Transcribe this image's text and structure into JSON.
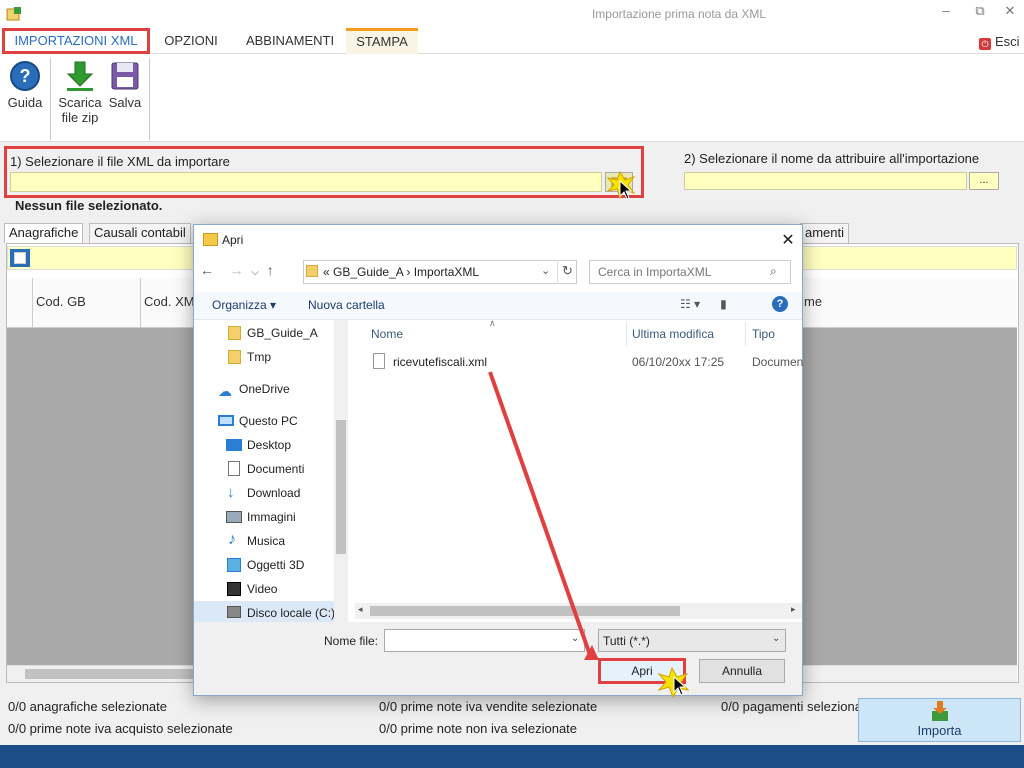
{
  "window": {
    "title": "Importazione prima nota da XML",
    "minimize_glyph": "–",
    "restore_glyph": "⧉",
    "close_glyph": "✕"
  },
  "ribbon": {
    "tabs": [
      "IMPORTAZIONI XML",
      "OPZIONI",
      "ABBINAMENTI",
      "STAMPA"
    ],
    "exit_label": "Esci"
  },
  "toolbar": {
    "guida": "Guida",
    "scarica_line1": "Scarica",
    "scarica_line2": "file zip",
    "salva": "Salva"
  },
  "step1": {
    "label": "1) Selezionare il file XML da importare",
    "status": "Nessun file selezionato."
  },
  "step2": {
    "label": "2) Selezionare il nome da attribuire all'importazione",
    "browse_label": "..."
  },
  "grid": {
    "tabs": [
      "Anagrafiche",
      "Causali contabil",
      "amenti"
    ],
    "columns": [
      "Cod. GB",
      "Cod. XM",
      "me"
    ]
  },
  "status": {
    "anagrafiche": "0/0 anagrafiche selezionate",
    "iva_acquisto": "0/0 prime note iva acquisto selezionate",
    "iva_vendite": "0/0 prime note iva vendite selezionate",
    "non_iva": "0/0 prime note non iva selezionate",
    "pagamenti": "0/0 pagamenti selezionati"
  },
  "importa_label": "Importa",
  "dialog": {
    "title": "Apri",
    "address_path": "«  GB_Guide_A  ›  ImportaXML",
    "search_placeholder": "Cerca in ImportaXML",
    "organizza": "Organizza ▾",
    "nuova_cartella": "Nuova cartella",
    "nav_items": [
      "GB_Guide_A",
      "Tmp",
      "OneDrive",
      "Questo PC",
      "Desktop",
      "Documenti",
      "Download",
      "Immagini",
      "Musica",
      "Oggetti 3D",
      "Video",
      "Disco locale (C:)"
    ],
    "columns": [
      "Nome",
      "Ultima modifica",
      "Tipo"
    ],
    "file": {
      "name": "ricevutefiscali.xml",
      "modified": "06/10/20xx 17:25",
      "type": "Documen"
    },
    "filename_label": "Nome file:",
    "filetype_selected": "Tutti (*.*)",
    "open_button": "Apri",
    "cancel_button": "Annulla"
  },
  "colors": {
    "highlight_red": "#e04040",
    "input_yellow": "#ffffc0",
    "bottom_bar": "#1d4d87",
    "accent_blue": "#2a6ebb"
  }
}
